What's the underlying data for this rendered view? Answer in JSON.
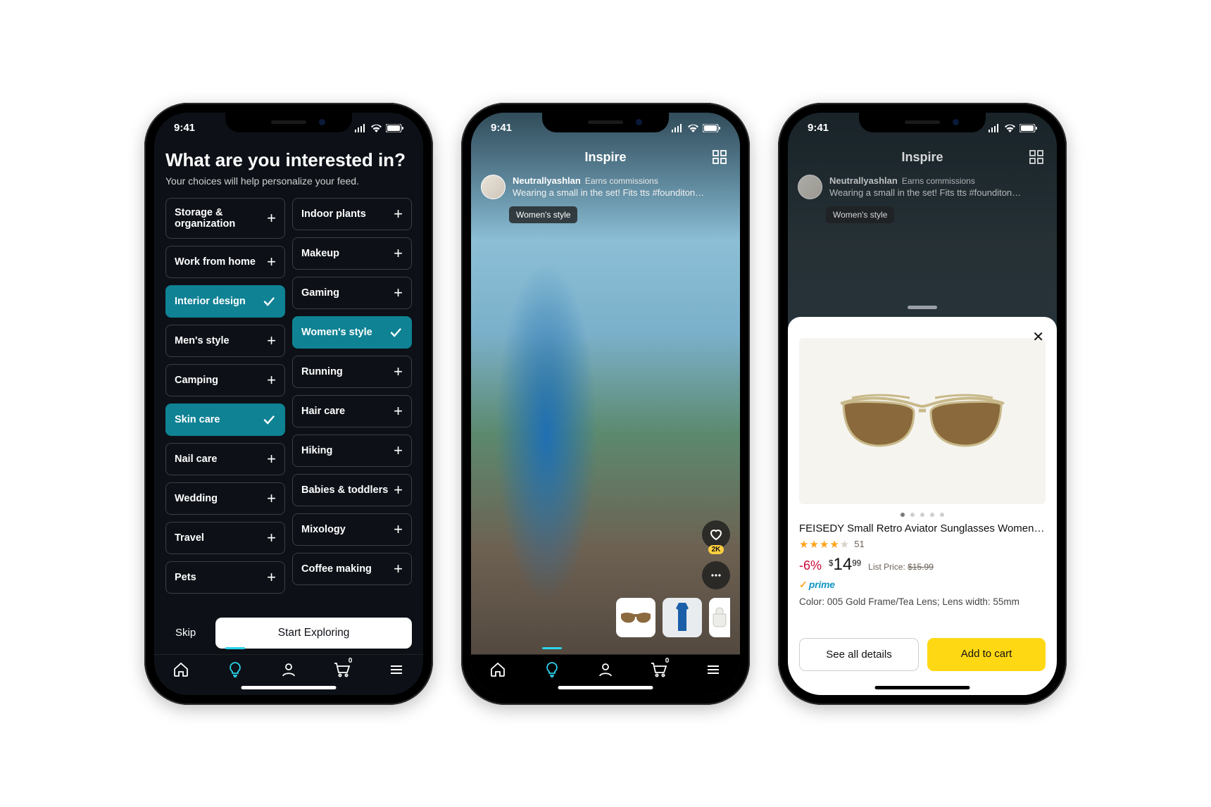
{
  "status": {
    "time": "9:41"
  },
  "nav": {
    "cart_count": "0"
  },
  "phone1": {
    "title": "What are you interested in?",
    "subtitle": "Your choices will help personalize your feed.",
    "skip": "Skip",
    "start": "Start Exploring",
    "left_chips": [
      {
        "label": "Storage & organization",
        "selected": false,
        "tall": true
      },
      {
        "label": "Work from home",
        "selected": false
      },
      {
        "label": "Interior design",
        "selected": true
      },
      {
        "label": "Men's style",
        "selected": false
      },
      {
        "label": "Camping",
        "selected": false
      },
      {
        "label": "Skin care",
        "selected": true
      },
      {
        "label": "Nail care",
        "selected": false
      },
      {
        "label": "Wedding",
        "selected": false
      },
      {
        "label": "Travel",
        "selected": false
      },
      {
        "label": "Pets",
        "selected": false
      }
    ],
    "right_chips": [
      {
        "label": "Indoor plants",
        "selected": false
      },
      {
        "label": "Makeup",
        "selected": false
      },
      {
        "label": "Gaming",
        "selected": false
      },
      {
        "label": "Women's style",
        "selected": true
      },
      {
        "label": "Running",
        "selected": false
      },
      {
        "label": "Hair care",
        "selected": false
      },
      {
        "label": "Hiking",
        "selected": false
      },
      {
        "label": "Babies & toddlers",
        "selected": false
      },
      {
        "label": "Mixology",
        "selected": false
      },
      {
        "label": "Coffee making",
        "selected": false
      }
    ]
  },
  "phone2": {
    "screen_title": "Inspire",
    "author": "Neutrallyashlan",
    "earns": "Earns commissions",
    "caption": "Wearing a small in the set! Fits tts #founditon…",
    "tag": "Women's style",
    "like_count": "2K"
  },
  "phone3": {
    "screen_title": "Inspire",
    "author": "Neutrallyashlan",
    "earns": "Earns commissions",
    "caption": "Wearing a small in the set! Fits tts #founditon…",
    "tag": "Women's style",
    "product": {
      "title": "FEISEDY Small Retro Aviator Sunglasses Women Men…",
      "rating_count": "51",
      "discount": "-6%",
      "price_dollar": "$",
      "price_whole": "14",
      "price_cents": "99",
      "list_label": "List Price:",
      "list_price": "$15.99",
      "prime": "prime",
      "variant": "Color: 005 Gold Frame/Tea Lens; Lens width: 55mm",
      "details_btn": "See all details",
      "add_btn": "Add to cart"
    }
  }
}
